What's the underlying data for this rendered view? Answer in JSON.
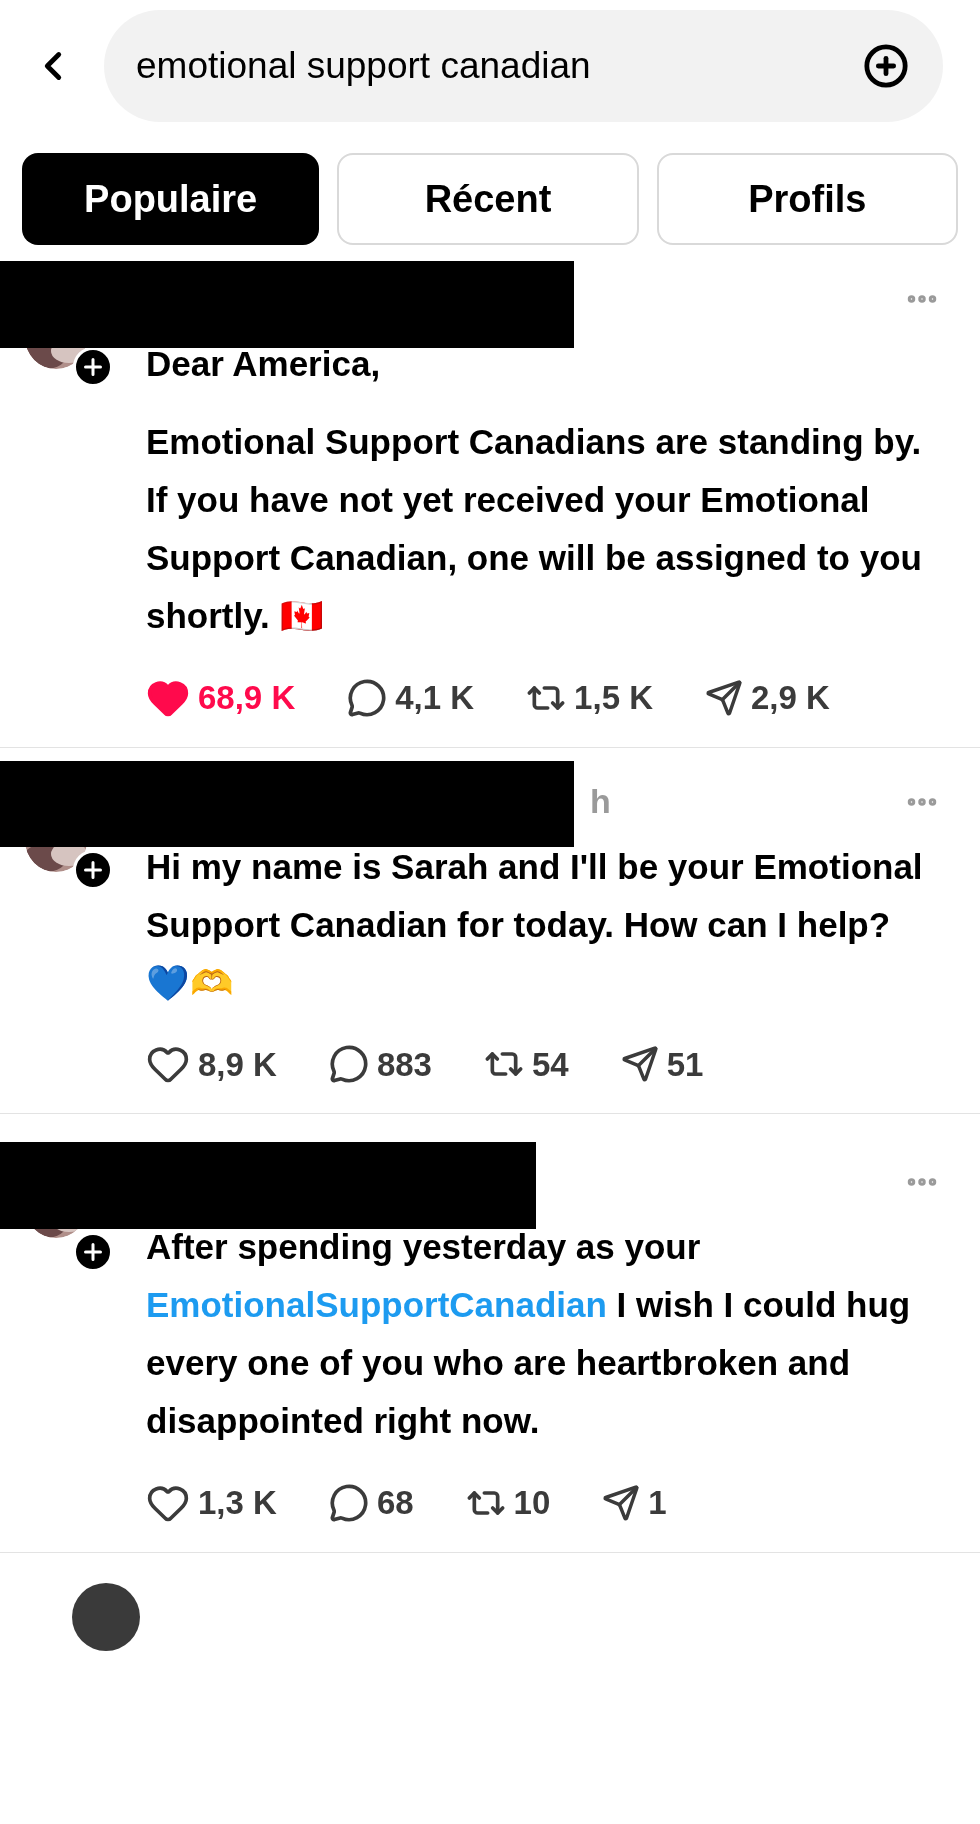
{
  "search": {
    "value": "emotional support canadian"
  },
  "tabs": [
    {
      "label": "Populaire",
      "selected": true
    },
    {
      "label": "Récent",
      "selected": false
    },
    {
      "label": "Profils",
      "selected": false
    }
  ],
  "posts": [
    {
      "body": [
        {
          "parts": [
            {
              "kind": "text",
              "text": "Dear America,"
            }
          ]
        },
        {
          "parts": [
            {
              "kind": "text",
              "text": "Emotional Support Canadians are standing by."
            }
          ]
        },
        {
          "parts": [
            {
              "kind": "text",
              "text": "If you have not yet received your Emotional Support Canadian, one will be assigned to you shortly. 🇨🇦"
            }
          ]
        }
      ],
      "actions": {
        "liked": true,
        "likes": "68,9 K",
        "comments": "4,1 K",
        "reposts": "1,5 K",
        "shares": "2,9 K"
      }
    },
    {
      "timestamp": "h",
      "body": [
        {
          "parts": [
            {
              "kind": "text",
              "text": "Hi my name is Sarah and I'll be your Emotional Support Canadian for today. How can I help?"
            }
          ]
        },
        {
          "parts": [
            {
              "kind": "text",
              "text": "💙🫶"
            }
          ]
        }
      ],
      "actions": {
        "liked": false,
        "likes": "8,9 K",
        "comments": "883",
        "reposts": "54",
        "shares": "51"
      }
    },
    {
      "body": [
        {
          "parts": [
            {
              "kind": "text",
              "text": "After spending yesterday as your "
            },
            {
              "kind": "tag",
              "text": "EmotionalSupportCanadian"
            },
            {
              "kind": "text",
              "text": " I wish I could hug every one of you who are heartbroken and disappointed right now."
            }
          ]
        }
      ],
      "actions": {
        "liked": false,
        "likes": "1,3 K",
        "comments": "68",
        "reposts": "10",
        "shares": "1"
      }
    }
  ]
}
